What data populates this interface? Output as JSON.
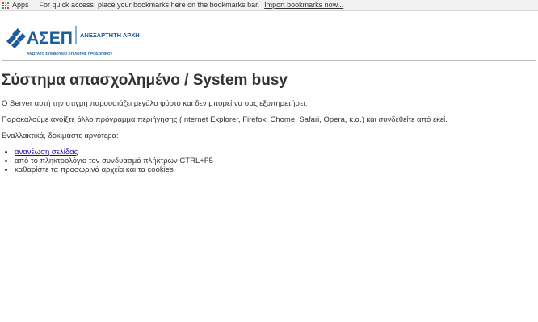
{
  "bookmarks_bar": {
    "apps_label": "Apps",
    "message": "For quick access, place your bookmarks here on the bookmarks bar.",
    "import_link": "Import bookmarks now..."
  },
  "header": {
    "logo_text": "ΑΣΕΠ",
    "logo_subtitle": "ΑΝΕΞΑΡΤΗΤΗ ΑΡΧΗ",
    "logo_tagline": "ΑΝΩΤΑΤΟ ΣΥΜΒΟΥΛΙΟ ΕΠΙΛΟΓΗΣ ΠΡΟΣΩΠΙΚΟΥ",
    "brand_color": "#1c5d9c"
  },
  "main": {
    "title": "Σύστημα απασχολημένο / System busy",
    "paragraph_1": "Ο Server αυτή την στιγμή παρουσιάζει μεγάλο φόρτο και δεν μπορεί να σας εξυπηρετήσει.",
    "paragraph_2": "Παρακαλούμε ανοίξτε άλλο πρόγραμμα περιήγησης (Internet Explorer, Firefox, Chome, Safari, Opera, κ.α.) και συνδεθείτε από εκεί.",
    "paragraph_3": "Εναλλακτικά, δοκιμάστε αργότερα:",
    "options": [
      "ανανέωση σελίδας",
      "από το πληκτρολόγιο τον συνδυασμό πλήκτρων CTRL+F5",
      "καθαρίστε τα προσωρινά αρχεία και τα cookies"
    ]
  }
}
